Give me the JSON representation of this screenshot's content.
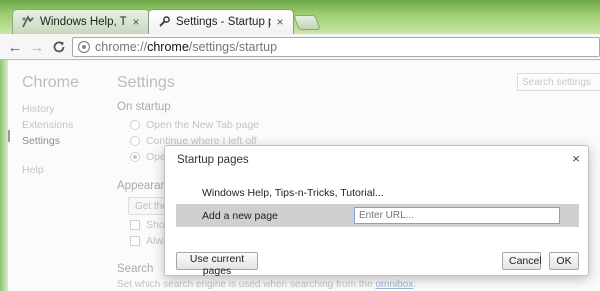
{
  "tabs": [
    {
      "title": "Windows Help, Tips-n-Tricks",
      "close": "×",
      "icon": "windows-help-favicon-icon",
      "active": false
    },
    {
      "title": "Settings - Startup pages",
      "close": "×",
      "icon": "wrench-icon",
      "active": true
    }
  ],
  "toolbar": {
    "back": "←",
    "forward": "→",
    "reload": "C",
    "url": {
      "scheme": "chrome://",
      "host": "chrome",
      "path": "/settings/startup"
    }
  },
  "sidebar": {
    "title": "Chrome",
    "items": [
      "History",
      "Extensions",
      "Settings"
    ],
    "active_index": 2,
    "help": "Help"
  },
  "settings": {
    "title": "Settings",
    "search_placeholder": "Search settings",
    "on_startup": {
      "title": "On startup",
      "options": [
        "Open the New Tab page",
        "Continue where I left off",
        "Ope"
      ],
      "selected_index": 2
    },
    "appearance": {
      "title": "Appearanc",
      "button": "Get the",
      "checkboxes": [
        "Show",
        "Alwa"
      ]
    },
    "search": {
      "title": "Search",
      "description": "Set which search engine is used when searching from the ",
      "link": "omnibox",
      "suffix": "."
    }
  },
  "dialog": {
    "title": "Startup pages",
    "close": "×",
    "pages": [
      "Windows Help, Tips-n-Tricks, Tutorial..."
    ],
    "add_label": "Add a new page",
    "url_placeholder": "Enter URL...",
    "use_current": "Use current pages",
    "cancel": "Cancel",
    "ok": "OK"
  },
  "colors": {
    "frame": "#9ccc6f",
    "input_focus": "#7aa4d6",
    "selected_row": "#cfcfcf"
  }
}
